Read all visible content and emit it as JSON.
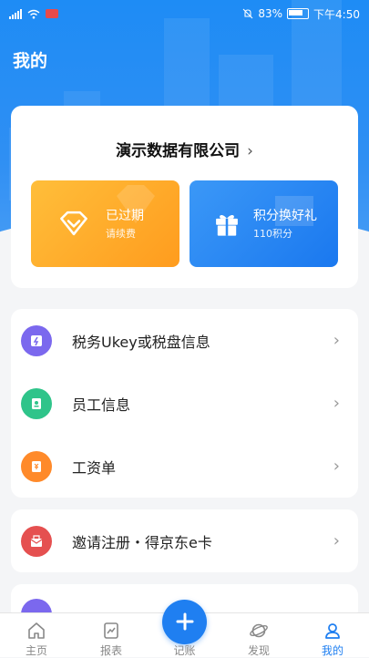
{
  "status_bar": {
    "battery": "83%",
    "time": "下午4:50"
  },
  "header": {
    "title": "我的"
  },
  "company": {
    "name": "演示数据有限公司",
    "chevron": "›"
  },
  "tiles": {
    "expired": {
      "title": "已过期",
      "subtitle": "请续费",
      "icon": "diamond-icon"
    },
    "points": {
      "title": "积分换好礼",
      "subtitle": "110积分",
      "icon": "gift-icon"
    }
  },
  "menu": [
    {
      "label": "税务Ukey或税盘信息",
      "icon": "ukey-icon",
      "color": "#7b68ee"
    },
    {
      "label": "员工信息",
      "icon": "badge-icon",
      "color": "#2fc48a"
    },
    {
      "label": "工资单",
      "icon": "payroll-icon",
      "color": "#ff8a2a"
    }
  ],
  "invite": {
    "label": "邀请注册・得京东e卡",
    "icon": "envelope-icon",
    "color": "#e55050"
  },
  "arrow": "›",
  "tabbar": {
    "home": "主页",
    "report": "报表",
    "add": "记账",
    "discover": "发现",
    "mine": "我的"
  },
  "colors": {
    "accent": "#1f7ff1",
    "orange": "#ff9c1e"
  }
}
